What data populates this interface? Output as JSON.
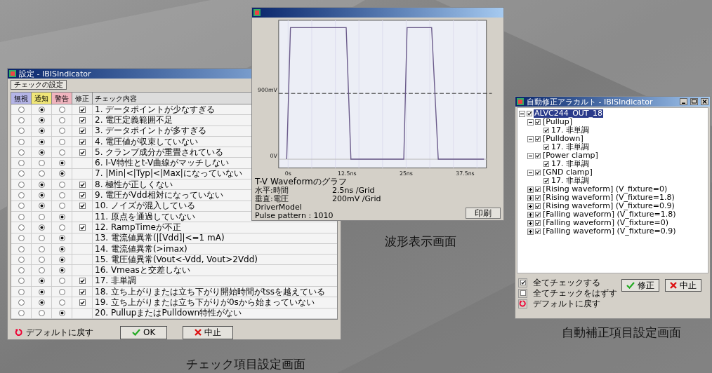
{
  "check_window": {
    "title": "設定 - IBISIndicator",
    "tabs": [
      {
        "label": "チェックの設定",
        "selected": true
      }
    ],
    "columns": [
      {
        "label": "無視",
        "color": "#b4b4e6"
      },
      {
        "label": "通知",
        "color": "#f0e678"
      },
      {
        "label": "警告",
        "color": "#f0b4be"
      },
      {
        "label": "修正"
      },
      {
        "label": "チェック内容"
      }
    ],
    "rows": [
      {
        "ignore": false,
        "notify": true,
        "warn": false,
        "fix": true,
        "text": "1. データポイントが少なすぎる"
      },
      {
        "ignore": false,
        "notify": true,
        "warn": false,
        "fix": true,
        "text": "2. 電圧定義範囲不足"
      },
      {
        "ignore": false,
        "notify": true,
        "warn": false,
        "fix": true,
        "text": "3. データポイントが多すぎる"
      },
      {
        "ignore": false,
        "notify": true,
        "warn": false,
        "fix": true,
        "text": "4. 電圧値が収束していない"
      },
      {
        "ignore": false,
        "notify": true,
        "warn": false,
        "fix": true,
        "text": "5. クランプ成分が重畳されている"
      },
      {
        "ignore": false,
        "notify": false,
        "warn": true,
        "fix": false,
        "text": "6. I-V特性とt-V曲線がマッチしない"
      },
      {
        "ignore": false,
        "notify": false,
        "warn": true,
        "fix": false,
        "text": "7. |Min|<|Typ|<|Max|になっていない"
      },
      {
        "ignore": false,
        "notify": true,
        "warn": false,
        "fix": true,
        "text": "8. 極性が正しくない"
      },
      {
        "ignore": false,
        "notify": true,
        "warn": false,
        "fix": true,
        "text": "9. 電圧がVdd相対になっていない"
      },
      {
        "ignore": false,
        "notify": true,
        "warn": false,
        "fix": true,
        "text": "10. ノイズが混入している"
      },
      {
        "ignore": false,
        "notify": false,
        "warn": true,
        "fix": false,
        "text": "11. 原点を通過していない"
      },
      {
        "ignore": false,
        "notify": true,
        "warn": false,
        "fix": true,
        "text": "12. RampTimeが不正"
      },
      {
        "ignore": false,
        "notify": false,
        "warn": true,
        "fix": false,
        "text": "13. 電流値異常(|[Vdd]|<=1 mA)"
      },
      {
        "ignore": false,
        "notify": false,
        "warn": true,
        "fix": false,
        "text": "14. 電流値異常(>imax)"
      },
      {
        "ignore": false,
        "notify": false,
        "warn": true,
        "fix": false,
        "text": "15. 電圧値異常(Vout<-Vdd, Vout>2Vdd)"
      },
      {
        "ignore": false,
        "notify": false,
        "warn": true,
        "fix": false,
        "text": "16. Vmeasと交差しない"
      },
      {
        "ignore": false,
        "notify": true,
        "warn": false,
        "fix": true,
        "text": "17. 非単調"
      },
      {
        "ignore": false,
        "notify": true,
        "warn": false,
        "fix": true,
        "text": "18. 立ち上がりまたは立ち下がり開始時間がtssを越えている"
      },
      {
        "ignore": false,
        "notify": true,
        "warn": false,
        "fix": true,
        "text": "19. 立ち上がりまたは立ち下がりが0sから始まっていない"
      },
      {
        "ignore": false,
        "notify": false,
        "warn": true,
        "fix": false,
        "text": "20. PullupまたはPulldown特性がない"
      }
    ],
    "buttons": [
      {
        "kind": "reset",
        "label": "デフォルトに戻す"
      },
      {
        "kind": "ok",
        "label": "OK"
      },
      {
        "kind": "cancel",
        "label": "中止"
      }
    ],
    "caption": "チェック項目設定画面"
  },
  "waveform_window": {
    "chart_data": {
      "type": "line",
      "x": [
        -0.3,
        0.5,
        12.3,
        13.3,
        24.5,
        25.2,
        30.4,
        31.8,
        41.5
      ],
      "series": [
        {
          "color": "#6a5a8a",
          "values": [
            0,
            1800,
            1800,
            0,
            0,
            1800,
            1800,
            0,
            0
          ]
        }
      ],
      "xlim": [
        -2,
        42
      ],
      "ylim": [
        -120,
        1900
      ],
      "xticks": [
        {
          "value": 0,
          "label": "0s"
        },
        {
          "value": 12.5,
          "label": "12.5ns"
        },
        {
          "value": 25,
          "label": "25ns"
        },
        {
          "value": 37.5,
          "label": "37.5ns"
        }
      ],
      "yticks": [
        {
          "value": 0,
          "label": "0V"
        },
        {
          "value": 900,
          "label": "900mV"
        }
      ],
      "ref_lines": [
        {
          "axis": "y",
          "value": 900
        }
      ]
    },
    "graph_title": "T-V Waveformのグラフ",
    "info": [
      {
        "label": "水平:時間",
        "value": "2.5ns /Grid"
      },
      {
        "label": "垂直:電圧",
        "value": "200mV /Grid"
      },
      {
        "label": "DriverModel"
      },
      {
        "label": "Pulse pattern : 1010"
      }
    ],
    "print_button": "印刷",
    "caption": "波形表示画面"
  },
  "auto_fix_window": {
    "title": "自動修正アラカルト - IBISIndicator",
    "tree": [
      {
        "label": "ALVC244_OUT_18",
        "checked": true,
        "selected": true,
        "expanded": true,
        "children": [
          {
            "label": "[Pullup]",
            "checked": true,
            "selected": false,
            "expanded": true,
            "children": [
              {
                "label": "17. 非単調",
                "checked": true,
                "selected": false
              }
            ]
          },
          {
            "label": "[Pulldown]",
            "checked": true,
            "selected": false,
            "expanded": true,
            "children": [
              {
                "label": "17. 非単調",
                "checked": true,
                "selected": false
              }
            ]
          },
          {
            "label": "[Power clamp]",
            "checked": true,
            "selected": false,
            "expanded": true,
            "children": [
              {
                "label": "17. 非単調",
                "checked": true,
                "selected": false
              }
            ]
          },
          {
            "label": "[GND clamp]",
            "checked": true,
            "selected": false,
            "expanded": true,
            "children": [
              {
                "label": "17. 非単調",
                "checked": true,
                "selected": false
              }
            ]
          },
          {
            "label": "[Rising waveform] (V_fixture=0)",
            "checked": true,
            "selected": false,
            "expanded": false
          },
          {
            "label": "[Rising waveform] (V_fixture=1.8)",
            "checked": true,
            "selected": false,
            "expanded": false
          },
          {
            "label": "[Rising waveform] (V_fixture=0.9)",
            "checked": true,
            "selected": false,
            "expanded": false
          },
          {
            "label": "[Falling waveform] (V_fixture=1.8)",
            "checked": true,
            "selected": false,
            "expanded": false
          },
          {
            "label": "[Falling waveform] (V_fixture=0)",
            "checked": true,
            "selected": false,
            "expanded": false
          },
          {
            "label": "[Falling waveform] (V_fixture=0.9)",
            "checked": true,
            "selected": false,
            "expanded": false
          }
        ]
      }
    ],
    "options": [
      {
        "kind": "check",
        "label": "全てチェックする",
        "checked": true
      },
      {
        "kind": "check",
        "label": "全てチェックをはずす",
        "checked": false
      },
      {
        "kind": "reset",
        "label": "デフォルトに戻す"
      }
    ],
    "buttons": [
      {
        "kind": "ok",
        "label": "修正"
      },
      {
        "kind": "cancel",
        "label": "中止"
      }
    ],
    "caption": "自動補正項目設定画面"
  }
}
